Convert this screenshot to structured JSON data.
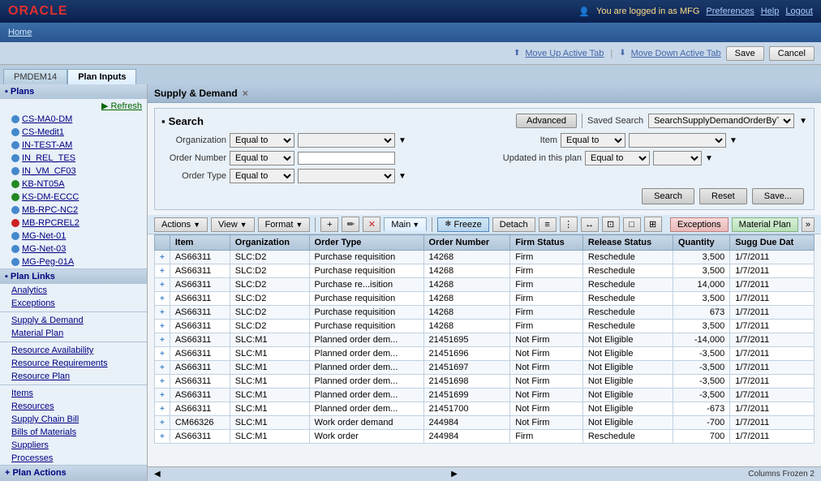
{
  "topbar": {
    "logo": "ORACLE",
    "user_info": "You are logged in as MFG",
    "nav_links": [
      "Preferences",
      "Help",
      "Logout"
    ]
  },
  "navbar": {
    "home": "Home"
  },
  "actionbar": {
    "move_up_label": "Move Up Active Tab",
    "move_down_label": "Move Down Active Tab",
    "save_label": "Save",
    "cancel_label": "Cancel"
  },
  "tabs": [
    {
      "id": "pmdem14",
      "label": "PMDEM14"
    },
    {
      "id": "plan-inputs",
      "label": "Plan Inputs",
      "active": true
    }
  ],
  "sidebar": {
    "plans_section": "Plans",
    "refresh_label": "Refresh",
    "plan_items": [
      {
        "id": "cs-ma0-dm",
        "label": "CS-MA0-DM",
        "icon": "dot-blue"
      },
      {
        "id": "cs-medit1",
        "label": "CS-Medit1",
        "icon": "dot-blue"
      },
      {
        "id": "in-test-am",
        "label": "IN-TEST-AM",
        "icon": "dot-blue"
      },
      {
        "id": "in-rel-tes",
        "label": "IN_REL_TES",
        "icon": "dot-blue"
      },
      {
        "id": "in-vm-cf03",
        "label": "IN_VM_CF03",
        "icon": "dot-blue"
      },
      {
        "id": "kb-nt05a",
        "label": "KB-NT05A",
        "icon": "dot-green"
      },
      {
        "id": "ks-dm-eccc",
        "label": "KS-DM-ECCC",
        "icon": "dot-green"
      },
      {
        "id": "mb-rpc-nc2",
        "label": "MB-RPC-NC2",
        "icon": "dot-blue"
      },
      {
        "id": "mb-rpcrel2",
        "label": "MB-RPCREL2",
        "icon": "dot-red"
      },
      {
        "id": "mg-net-01",
        "label": "MG-Net-01",
        "icon": "dot-blue"
      },
      {
        "id": "mg-net-03",
        "label": "MG-Net-03",
        "icon": "dot-blue"
      },
      {
        "id": "mg-peg-01a",
        "label": "MG-Peg-01A",
        "icon": "dot-blue"
      }
    ],
    "plan_links_section": "Plan Links",
    "plan_links": [
      {
        "id": "analytics",
        "label": "Analytics"
      },
      {
        "id": "exceptions",
        "label": "Exceptions"
      }
    ],
    "supply_demand_label": "Supply & Demand",
    "material_plan_label": "Material Plan",
    "resource_section": {
      "availability": "Resource Availability",
      "requirements": "Resource Requirements",
      "plan": "Resource Plan"
    },
    "items_section": {
      "items": "Items",
      "resources": "Resources",
      "supply_chain_bill": "Supply Chain Bill",
      "bills_of_materials": "Bills of Materials",
      "suppliers": "Suppliers",
      "processes": "Processes"
    },
    "plan_actions_section": "Plan Actions"
  },
  "panel": {
    "title": "Supply & Demand",
    "close": "×"
  },
  "search": {
    "title": "Search",
    "advanced_btn": "Advanced",
    "saved_search_label": "Saved Search",
    "saved_search_value": "SearchSupplyDemandOrderByTrxId",
    "fields": {
      "organization_label": "Organization",
      "organization_op": "Equal to",
      "order_number_label": "Order Number",
      "order_number_op": "Equal to",
      "order_type_label": "Order Type",
      "order_type_op": "Equal to",
      "item_label": "Item",
      "item_op": "Equal to",
      "updated_label": "Updated in this plan",
      "updated_op": "Equal to"
    },
    "search_btn": "Search",
    "reset_btn": "Reset",
    "save_btn": "Save..."
  },
  "toolbar": {
    "actions_label": "Actions",
    "view_label": "View",
    "format_label": "Format",
    "main_tab_label": "Main",
    "freeze_btn": "Freeze",
    "detach_btn": "Detach",
    "exceptions_btn": "Exceptions",
    "material_plan_btn": "Material Plan"
  },
  "table": {
    "columns": [
      "Item",
      "Organization",
      "Order Type",
      "Order Number",
      "Firm Status",
      "Release Status",
      "Quantity",
      "Sugg Due Dat"
    ],
    "rows": [
      {
        "item": "AS66311",
        "org": "SLC:D2",
        "order_type": "Purchase requisition",
        "order_num": "14268",
        "firm": "Firm",
        "release": "Reschedule",
        "qty": "3,500",
        "due": "1/7/2011"
      },
      {
        "item": "AS66311",
        "org": "SLC:D2",
        "order_type": "Purchase requisition",
        "order_num": "14268",
        "firm": "Firm",
        "release": "Reschedule",
        "qty": "3,500",
        "due": "1/7/2011"
      },
      {
        "item": "AS66311",
        "org": "SLC:D2",
        "order_type": "Purchase re...isition",
        "order_num": "14268",
        "firm": "Firm",
        "release": "Reschedule",
        "qty": "14,000",
        "due": "1/7/2011"
      },
      {
        "item": "AS66311",
        "org": "SLC:D2",
        "order_type": "Purchase requisition",
        "order_num": "14268",
        "firm": "Firm",
        "release": "Reschedule",
        "qty": "3,500",
        "due": "1/7/2011"
      },
      {
        "item": "AS66311",
        "org": "SLC:D2",
        "order_type": "Purchase requisition",
        "order_num": "14268",
        "firm": "Firm",
        "release": "Reschedule",
        "qty": "673",
        "due": "1/7/2011"
      },
      {
        "item": "AS66311",
        "org": "SLC:D2",
        "order_type": "Purchase requisition",
        "order_num": "14268",
        "firm": "Firm",
        "release": "Reschedule",
        "qty": "3,500",
        "due": "1/7/2011"
      },
      {
        "item": "AS66311",
        "org": "SLC:M1",
        "order_type": "Planned order dem...",
        "order_num": "21451695",
        "firm": "Not Firm",
        "release": "Not Eligible",
        "qty": "-14,000",
        "due": "1/7/2011"
      },
      {
        "item": "AS66311",
        "org": "SLC:M1",
        "order_type": "Planned order dem...",
        "order_num": "21451696",
        "firm": "Not Firm",
        "release": "Not Eligible",
        "qty": "-3,500",
        "due": "1/7/2011"
      },
      {
        "item": "AS66311",
        "org": "SLC:M1",
        "order_type": "Planned order dem...",
        "order_num": "21451697",
        "firm": "Not Firm",
        "release": "Not Eligible",
        "qty": "-3,500",
        "due": "1/7/2011"
      },
      {
        "item": "AS66311",
        "org": "SLC:M1",
        "order_type": "Planned order dem...",
        "order_num": "21451698",
        "firm": "Not Firm",
        "release": "Not Eligible",
        "qty": "-3,500",
        "due": "1/7/2011"
      },
      {
        "item": "AS66311",
        "org": "SLC:M1",
        "order_type": "Planned order dem...",
        "order_num": "21451699",
        "firm": "Not Firm",
        "release": "Not Eligible",
        "qty": "-3,500",
        "due": "1/7/2011"
      },
      {
        "item": "AS66311",
        "org": "SLC:M1",
        "order_type": "Planned order dem...",
        "order_num": "21451700",
        "firm": "Not Firm",
        "release": "Not Eligible",
        "qty": "-673",
        "due": "1/7/2011"
      },
      {
        "item": "CM66326",
        "org": "SLC:M1",
        "order_type": "Work order demand",
        "order_num": "244984",
        "firm": "Not Firm",
        "release": "Not Eligible",
        "qty": "-700",
        "due": "1/7/2011"
      },
      {
        "item": "AS66311",
        "org": "SLC:M1",
        "order_type": "Work order",
        "order_num": "244984",
        "firm": "Firm",
        "release": "Reschedule",
        "qty": "700",
        "due": "1/7/2011"
      }
    ]
  },
  "statusbar": {
    "columns_frozen_label": "Columns Frozen",
    "columns_frozen_count": "2"
  }
}
